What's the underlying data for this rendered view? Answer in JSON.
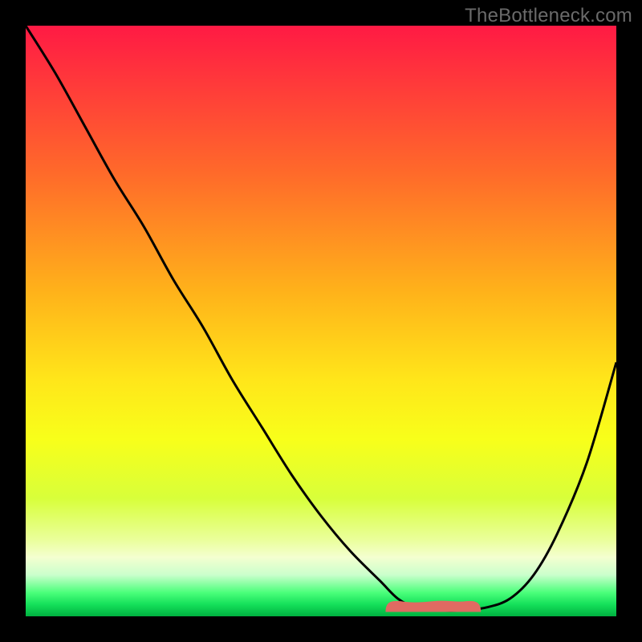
{
  "watermark": "TheBottleneck.com",
  "colors": {
    "background": "#000000",
    "curve": "#000000",
    "bumpFill": "#e06a62",
    "bumpStroke": "#e06a62"
  },
  "chart_data": {
    "type": "line",
    "title": "",
    "xlabel": "",
    "ylabel": "",
    "xlim": [
      0,
      100
    ],
    "ylim": [
      0,
      100
    ],
    "grid": false,
    "legend": false,
    "series": [
      {
        "name": "bottleneck-curve",
        "x": [
          0,
          5,
          10,
          15,
          20,
          25,
          30,
          35,
          40,
          45,
          50,
          55,
          60,
          63,
          66,
          70,
          74,
          78,
          82,
          86,
          90,
          95,
          100
        ],
        "y": [
          100,
          92,
          83,
          74,
          66,
          57,
          49,
          40,
          32,
          24,
          17,
          11,
          6,
          3,
          1.5,
          1,
          1,
          1.5,
          3,
          7,
          14,
          26,
          43
        ]
      }
    ],
    "annotations": [
      {
        "name": "optimal-range-bump",
        "x_range": [
          61,
          77
        ],
        "y": 2.5,
        "color": "#e06a62"
      }
    ]
  }
}
